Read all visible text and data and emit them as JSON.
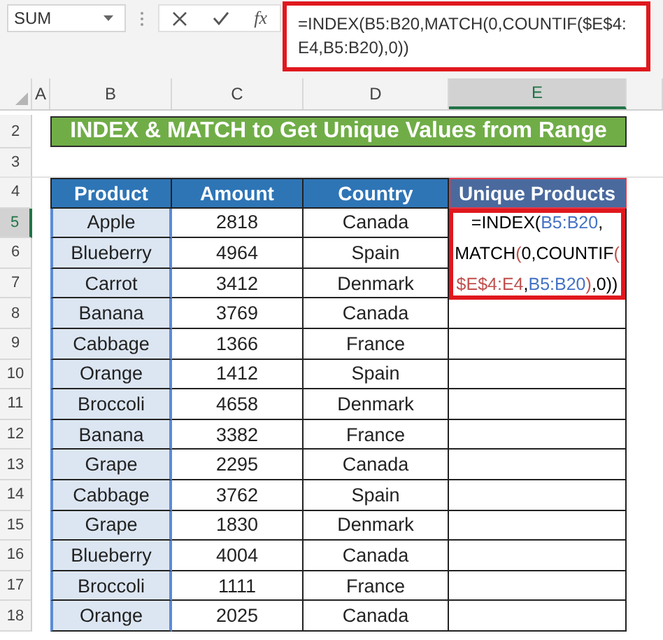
{
  "name_box": {
    "value": "SUM"
  },
  "formula_bar": {
    "fx": "fx",
    "formula": "=INDEX(B5:B20,MATCH(0,COUNTIF($E$4:E4,B5:B20),0))",
    "highlighted": true
  },
  "column_headers": [
    {
      "label": "A",
      "selected": false
    },
    {
      "label": "B",
      "selected": false
    },
    {
      "label": "C",
      "selected": false
    },
    {
      "label": "D",
      "selected": false
    },
    {
      "label": "E",
      "selected": true
    }
  ],
  "row_numbers": [
    {
      "label": "2",
      "selected": false
    },
    {
      "label": "3",
      "selected": false
    },
    {
      "label": "4",
      "selected": false
    },
    {
      "label": "5",
      "selected": true
    },
    {
      "label": "6",
      "selected": false
    },
    {
      "label": "7",
      "selected": false
    },
    {
      "label": "8",
      "selected": false
    },
    {
      "label": "9",
      "selected": false
    },
    {
      "label": "10",
      "selected": false
    },
    {
      "label": "11",
      "selected": false
    },
    {
      "label": "12",
      "selected": false
    },
    {
      "label": "13",
      "selected": false
    },
    {
      "label": "14",
      "selected": false
    },
    {
      "label": "15",
      "selected": false
    },
    {
      "label": "16",
      "selected": false
    },
    {
      "label": "17",
      "selected": false
    },
    {
      "label": "18",
      "selected": false
    }
  ],
  "title": "INDEX & MATCH to Get Unique Values from Range",
  "table": {
    "columns": [
      "Product",
      "Amount",
      "Country",
      "Unique Products"
    ],
    "rows": [
      [
        "Apple",
        "2818",
        "Canada"
      ],
      [
        "Blueberry",
        "4964",
        "Spain"
      ],
      [
        "Carrot",
        "3412",
        "Denmark"
      ],
      [
        "Banana",
        "3769",
        "Canada"
      ],
      [
        "Cabbage",
        "1366",
        "France"
      ],
      [
        "Orange",
        "1412",
        "Spain"
      ],
      [
        "Broccoli",
        "4658",
        "Denmark"
      ],
      [
        "Banana",
        "3382",
        "France"
      ],
      [
        "Grape",
        "2295",
        "Canada"
      ],
      [
        "Cabbage",
        "3762",
        "Spain"
      ],
      [
        "Grape",
        "1830",
        "Denmark"
      ],
      [
        "Blueberry",
        "4004",
        "Canada"
      ],
      [
        "Broccoli",
        "1111",
        "France"
      ],
      [
        "Orange",
        "2025",
        "Canada"
      ]
    ],
    "editing_cell": {
      "highlighted": true,
      "lines": [
        [
          {
            "text": "=INDEX(",
            "color": "#000000"
          },
          {
            "text": "B5:B20",
            "color": "#4472c4"
          },
          {
            "text": ",",
            "color": "#000000"
          }
        ],
        [
          {
            "text": "MATCH",
            "color": "#000000"
          },
          {
            "text": "(",
            "color": "#c0504d"
          },
          {
            "text": "0,COUNTIF",
            "color": "#000000"
          },
          {
            "text": "(",
            "color": "#c0504d"
          }
        ],
        [
          {
            "text": "$E$4:E4",
            "color": "#c0504d"
          },
          {
            "text": ",",
            "color": "#000000"
          },
          {
            "text": "B5:B20",
            "color": "#4472c4"
          },
          {
            "text": ")",
            "color": "#c0504d"
          },
          {
            "text": ",0))",
            "color": "#000000"
          }
        ]
      ]
    }
  }
}
